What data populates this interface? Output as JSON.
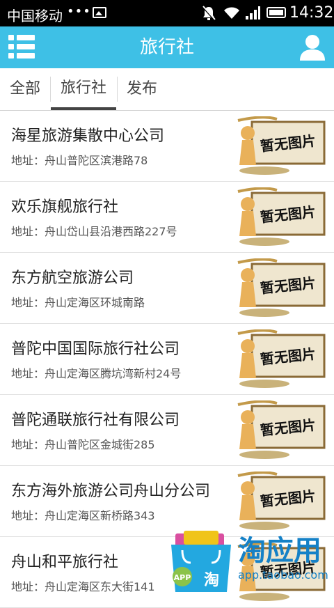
{
  "status_bar": {
    "carrier": "中国移动",
    "dots": "•••",
    "time": "14:32"
  },
  "header": {
    "title": "旅行社",
    "menu_icon": "list-menu-icon",
    "user_icon": "user-icon"
  },
  "tabs": [
    {
      "label": "全部",
      "active": false
    },
    {
      "label": "旅行社",
      "active": true
    },
    {
      "label": "发布",
      "active": false
    }
  ],
  "placeholder_image_text": "暂无图片",
  "agencies": [
    {
      "name": "海星旅游集散中心公司",
      "address": "地址：舟山普陀区滨港路78"
    },
    {
      "name": "欢乐旗舰旅行社",
      "address": "地址：舟山岱山县沿港西路227号"
    },
    {
      "name": "东方航空旅游公司",
      "address": "地址：舟山定海区环城南路"
    },
    {
      "name": "普陀中国国际旅行社公司",
      "address": "地址：舟山定海区腾坑湾新村24号"
    },
    {
      "name": "普陀通联旅行社有限公司",
      "address": "地址：舟山普陀区金城街285"
    },
    {
      "name": "东方海外旅游公司舟山分公司",
      "address": "地址：舟山定海区新桥路343"
    },
    {
      "name": "舟山和平旅行社",
      "address": "地址：舟山定海区东大街141"
    }
  ],
  "watermark": {
    "brand": "淘应用",
    "url": "app.taobao.com",
    "badge": "APP",
    "bag_char": "淘"
  },
  "colors": {
    "header_bg": "#3ec0e6",
    "status_bg": "#000000",
    "watermark_blue": "#1581c7"
  }
}
